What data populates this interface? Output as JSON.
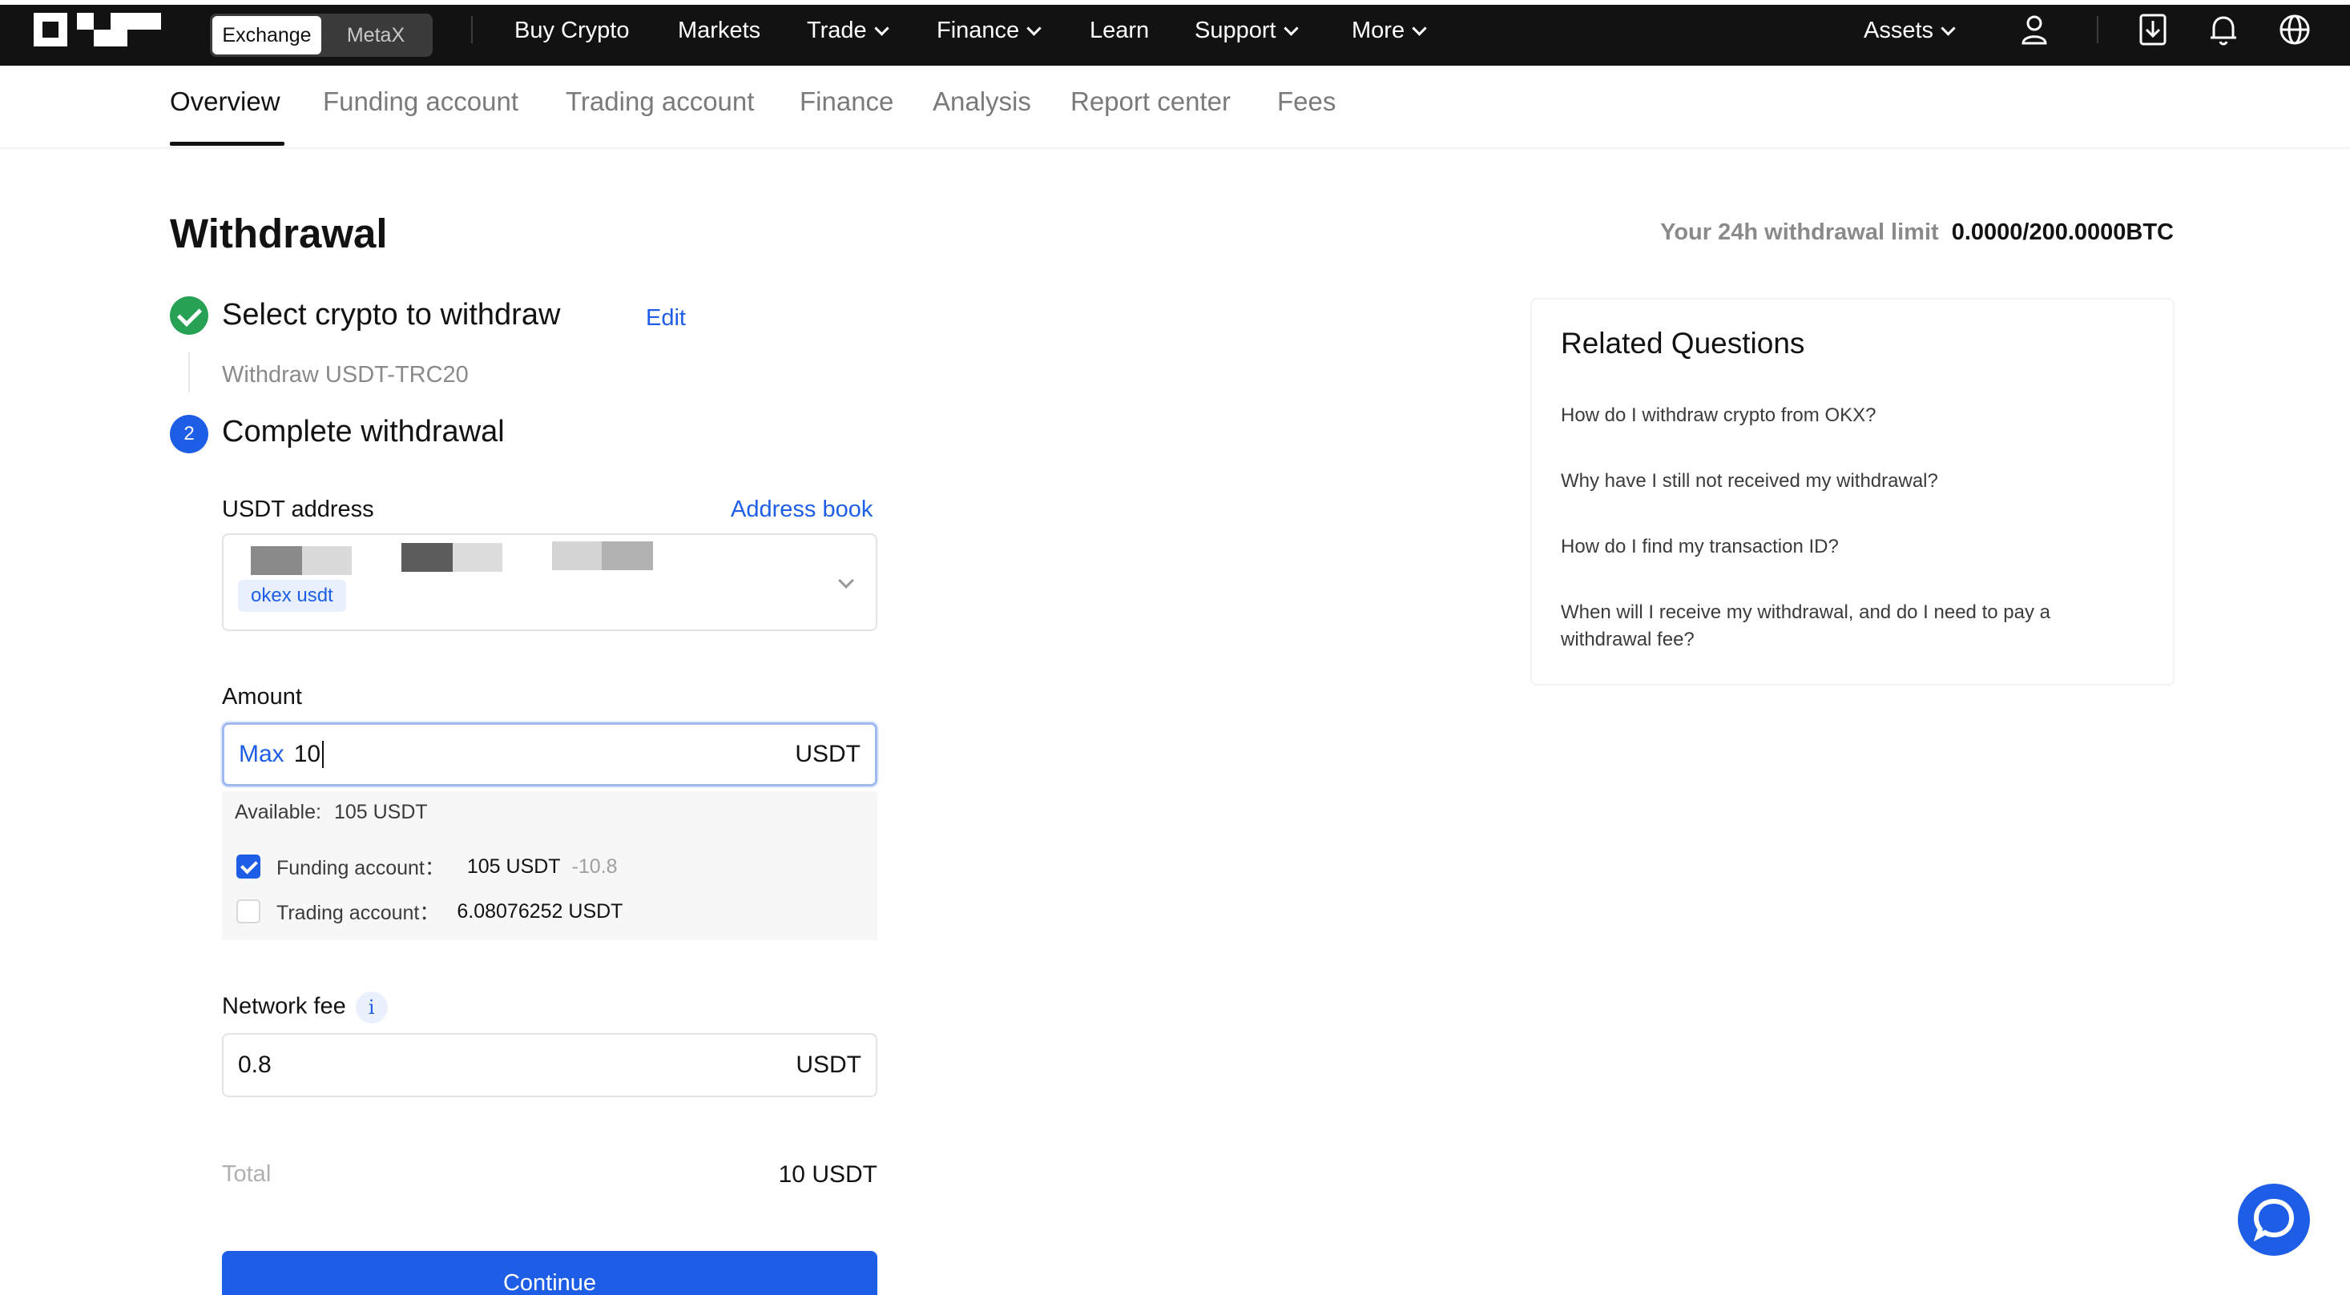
{
  "topbar": {
    "mode_switch": [
      "Exchange",
      "MetaX"
    ],
    "nav": {
      "buy_crypto": "Buy Crypto",
      "markets": "Markets",
      "trade": "Trade",
      "finance": "Finance",
      "learn": "Learn",
      "support": "Support",
      "more": "More"
    },
    "assets": "Assets",
    "icons": [
      "user-icon",
      "download-icon",
      "bell-icon",
      "globe-icon"
    ]
  },
  "subnav": {
    "tabs": [
      "Overview",
      "Funding account",
      "Trading account",
      "Finance",
      "Analysis",
      "Report center",
      "Fees"
    ],
    "active": "Overview"
  },
  "page": {
    "title": "Withdrawal",
    "limit_label": "Your 24h withdrawal limit",
    "limit_value": "0.0000/200.0000BTC"
  },
  "step1": {
    "title": "Select crypto to withdraw",
    "edit": "Edit",
    "subtitle": "Withdraw USDT-TRC20"
  },
  "step2": {
    "number": "2",
    "title": "Complete withdrawal"
  },
  "address": {
    "label": "USDT address",
    "address_book": "Address book",
    "tag": "okex usdt"
  },
  "amount": {
    "label": "Amount",
    "max": "Max",
    "value": "10",
    "unit": "USDT",
    "available_label": "Available:",
    "available_value": "105 USDT",
    "funding_label": "Funding account：",
    "funding_value": "105 USDT",
    "funding_delta": "-10.8",
    "funding_checked": true,
    "trading_label": "Trading account：",
    "trading_value": "6.08076252 USDT",
    "trading_checked": false
  },
  "network_fee": {
    "label": "Network fee",
    "info": "i",
    "value": "0.8",
    "unit": "USDT"
  },
  "total": {
    "label": "Total",
    "value": "10 USDT"
  },
  "continue_label": "Continue",
  "related": {
    "title": "Related Questions",
    "items": [
      "How do I withdraw crypto from OKX?",
      "Why have I still not received my withdrawal?",
      "How do I find my transaction ID?",
      "When will I receive my withdrawal, and do I need to pay a withdrawal fee?"
    ]
  },
  "colors": {
    "topbar": "#121212",
    "accent": "#1e5ee6",
    "success": "#27a154"
  }
}
